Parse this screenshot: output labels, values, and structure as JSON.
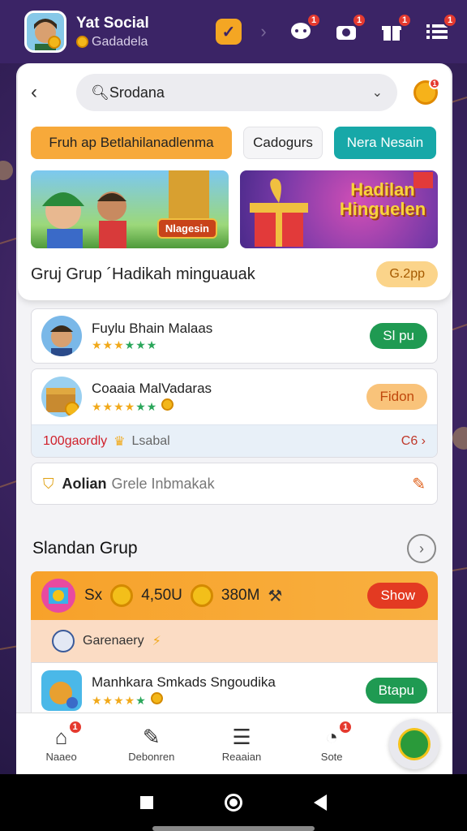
{
  "header": {
    "title": "Yat Social",
    "subtitle": "Gadadela",
    "badges": {
      "chat": "1",
      "camera": "1",
      "gift": "1",
      "menu": "1"
    }
  },
  "search": {
    "value": "Srodana"
  },
  "chips": [
    "Fruh ap Betlahilanadlenma",
    "Cadogurs",
    "Nera Nesain"
  ],
  "banners": {
    "left_label": "Nlagesin",
    "right_title": "Hadilan Hinguelen"
  },
  "group": {
    "title": "Gruj Grup ´Hadikah minguauak",
    "pill": "G.2pp"
  },
  "list": [
    {
      "name": "Fuylu Bhain Malaas",
      "action": "Sl pu"
    },
    {
      "name": "Coaaia MalVadaras",
      "action": "Fidon"
    }
  ],
  "strip": {
    "left": "100gaordly",
    "middle": "Lsabal",
    "right": "C6 ›"
  },
  "info": {
    "label": "Aolian",
    "text": "Grele Inbmakak"
  },
  "section": {
    "title": "Slandan Grup"
  },
  "featured": {
    "prefix": "Sx",
    "stat1": "4,50U",
    "stat2": "380M",
    "action": "Show",
    "category": "Garenaery",
    "item_name": "Manhkara Smkads Sngoudika",
    "item_action": "Btapu"
  },
  "nav": [
    {
      "label": "Naaeo",
      "badge": "1"
    },
    {
      "label": "Debonren",
      "badge": ""
    },
    {
      "label": "Reaaian",
      "badge": ""
    },
    {
      "label": "Sote",
      "badge": "1"
    }
  ],
  "colors": {
    "header_bg": "#3b2466",
    "accent_orange": "#f7a93a",
    "accent_teal": "#17a8a8",
    "accent_green": "#1f9a52",
    "accent_red": "#e33a22"
  }
}
